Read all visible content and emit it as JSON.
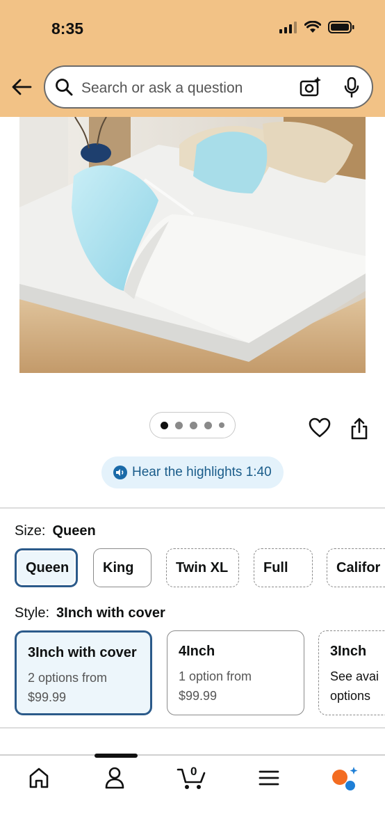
{
  "status_bar": {
    "time": "8:35"
  },
  "search": {
    "placeholder": "Search or ask a question"
  },
  "gallery": {
    "image_count": 5,
    "active_index": 0
  },
  "audio": {
    "label": "Hear the highlights 1:40"
  },
  "size": {
    "label": "Size:",
    "selected": "Queen",
    "options": [
      "Queen",
      "King",
      "Twin XL",
      "Full",
      "Califor"
    ]
  },
  "style": {
    "label": "Style:",
    "selected": "3Inch with cover",
    "options": [
      {
        "title": "3Inch with cover",
        "line1": "2 options from",
        "line2": "$99.99"
      },
      {
        "title": "4Inch",
        "line1": "1 option from",
        "line2": "$99.99"
      },
      {
        "title": "3Inch",
        "line1": "See avai",
        "line2": "options"
      }
    ]
  },
  "nav": {
    "cart_count": "0"
  },
  "colors": {
    "header_bg": "#f2c286",
    "selected_border": "#2b5a8a",
    "selected_bg": "#edf6fb",
    "audio_text": "#1a5c8a"
  }
}
